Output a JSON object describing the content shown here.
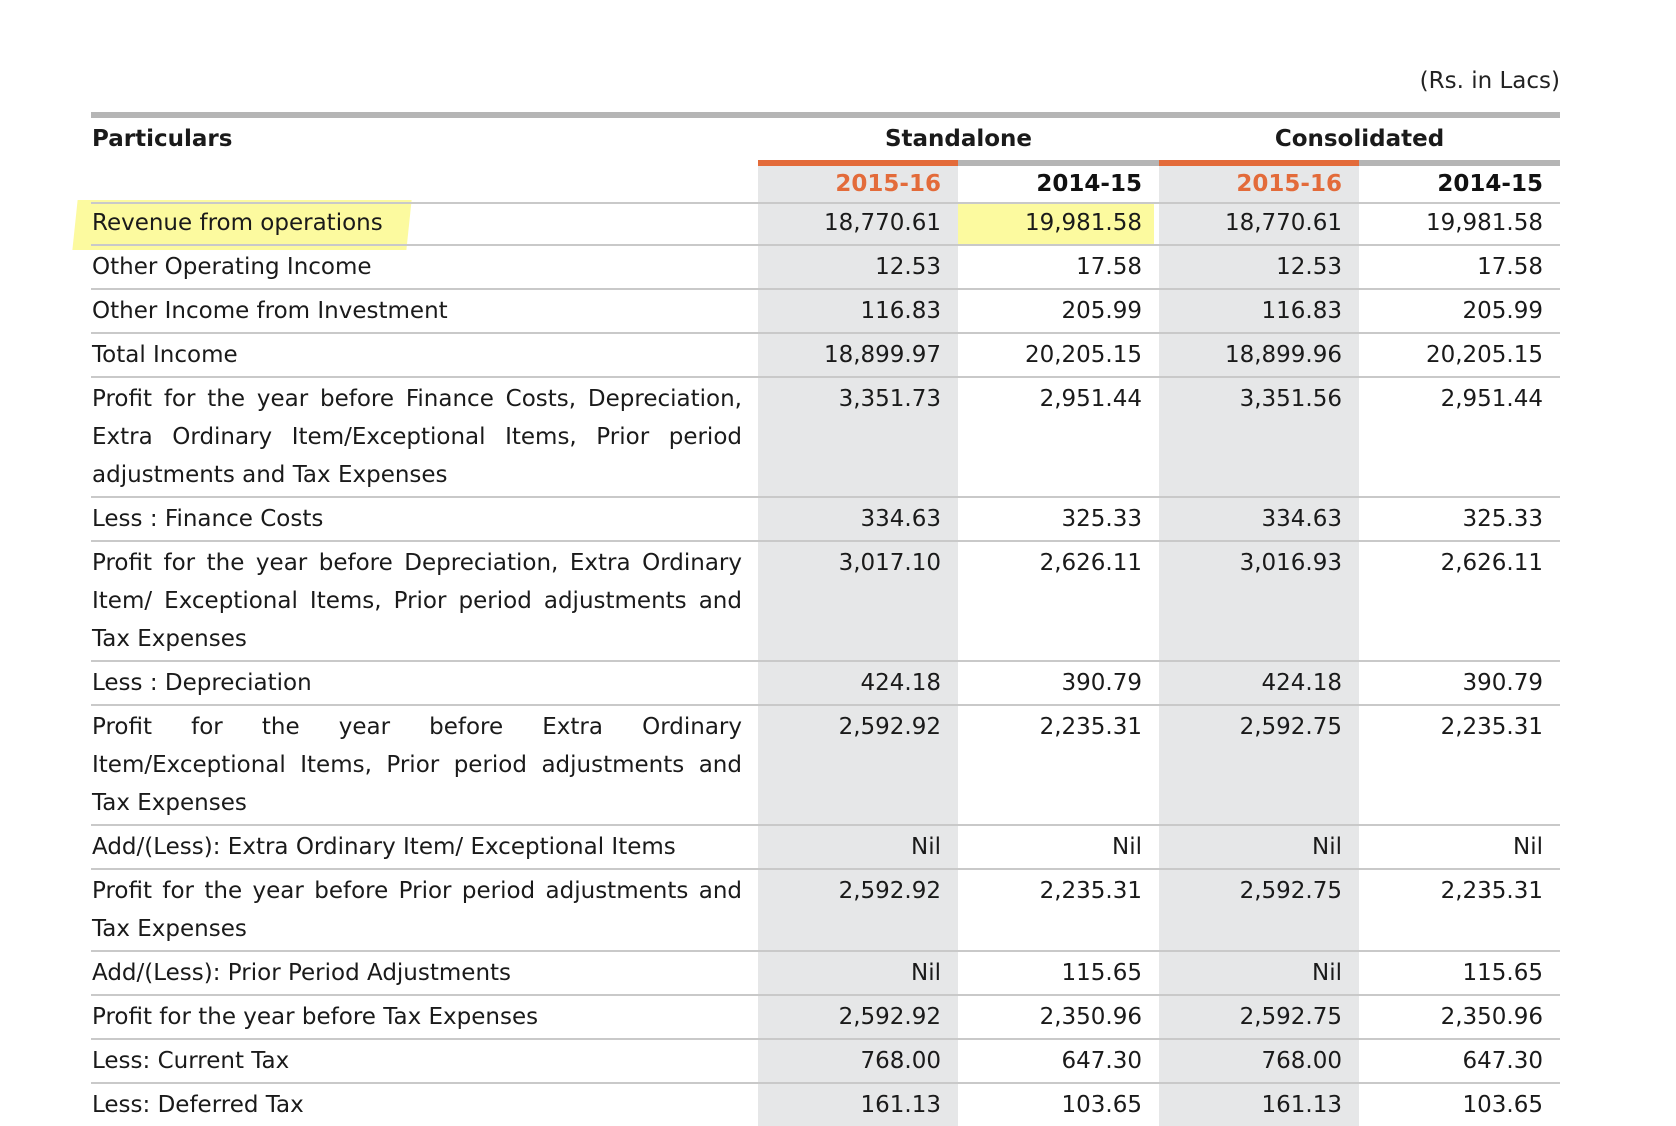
{
  "unit_note": "(Rs. in Lacs)",
  "header": {
    "particulars": "Particulars",
    "standalone": "Standalone",
    "consolidated": "Consolidated",
    "years": [
      "2015-16",
      "2014-15",
      "2015-16",
      "2014-15"
    ]
  },
  "colors": {
    "accent": "#e36b3a",
    "shade": "#e6e7e8",
    "highlight": "#faf550"
  },
  "rows": [
    {
      "label": "Revenue from operations",
      "values": [
        "18,770.61",
        "19,981.58",
        "18,770.61",
        "19,981.58"
      ]
    },
    {
      "label": "Other Operating Income",
      "values": [
        "12.53",
        "17.58",
        "12.53",
        "17.58"
      ]
    },
    {
      "label": "Other Income from Investment",
      "values": [
        "116.83",
        "205.99",
        "116.83",
        "205.99"
      ]
    },
    {
      "label": "Total Income",
      "values": [
        "18,899.97",
        "20,205.15",
        "18,899.96",
        "20,205.15"
      ]
    },
    {
      "label": "Profit for the year before Finance Costs, Depreciation, Extra Ordinary Item/Exceptional Items, Prior period adjustments and Tax Expenses",
      "values": [
        "3,351.73",
        "2,951.44",
        "3,351.56",
        "2,951.44"
      ]
    },
    {
      "label": "Less : Finance Costs",
      "values": [
        "334.63",
        "325.33",
        "334.63",
        "325.33"
      ]
    },
    {
      "label": "Profit for the year before Depreciation, Extra Ordinary Item/ Exceptional Items, Prior period adjustments and Tax Expenses",
      "values": [
        "3,017.10",
        "2,626.11",
        "3,016.93",
        "2,626.11"
      ]
    },
    {
      "label": "Less : Depreciation",
      "values": [
        "424.18",
        "390.79",
        "424.18",
        "390.79"
      ]
    },
    {
      "label": "Profit for the year before Extra Ordinary Item/Exceptional Items, Prior period adjustments and Tax Expenses",
      "values": [
        "2,592.92",
        "2,235.31",
        "2,592.75",
        "2,235.31"
      ]
    },
    {
      "label": "Add/(Less): Extra Ordinary Item/ Exceptional Items",
      "values": [
        "Nil",
        "Nil",
        "Nil",
        "Nil"
      ]
    },
    {
      "label": "Profit for the year before Prior period adjustments and Tax Expenses",
      "values": [
        "2,592.92",
        "2,235.31",
        "2,592.75",
        "2,235.31"
      ]
    },
    {
      "label": "Add/(Less): Prior Period Adjustments",
      "values": [
        "Nil",
        "115.65",
        "Nil",
        "115.65"
      ]
    },
    {
      "label": "Profit for the year before Tax Expenses",
      "values": [
        "2,592.92",
        "2,350.96",
        "2,592.75",
        "2,350.96"
      ]
    },
    {
      "label": "Less: Current Tax",
      "values": [
        "768.00",
        "647.30",
        "768.00",
        "647.30"
      ]
    },
    {
      "label": "Less: Deferred Tax",
      "values": [
        "161.13",
        "103.65",
        "161.13",
        "103.65"
      ]
    }
  ]
}
